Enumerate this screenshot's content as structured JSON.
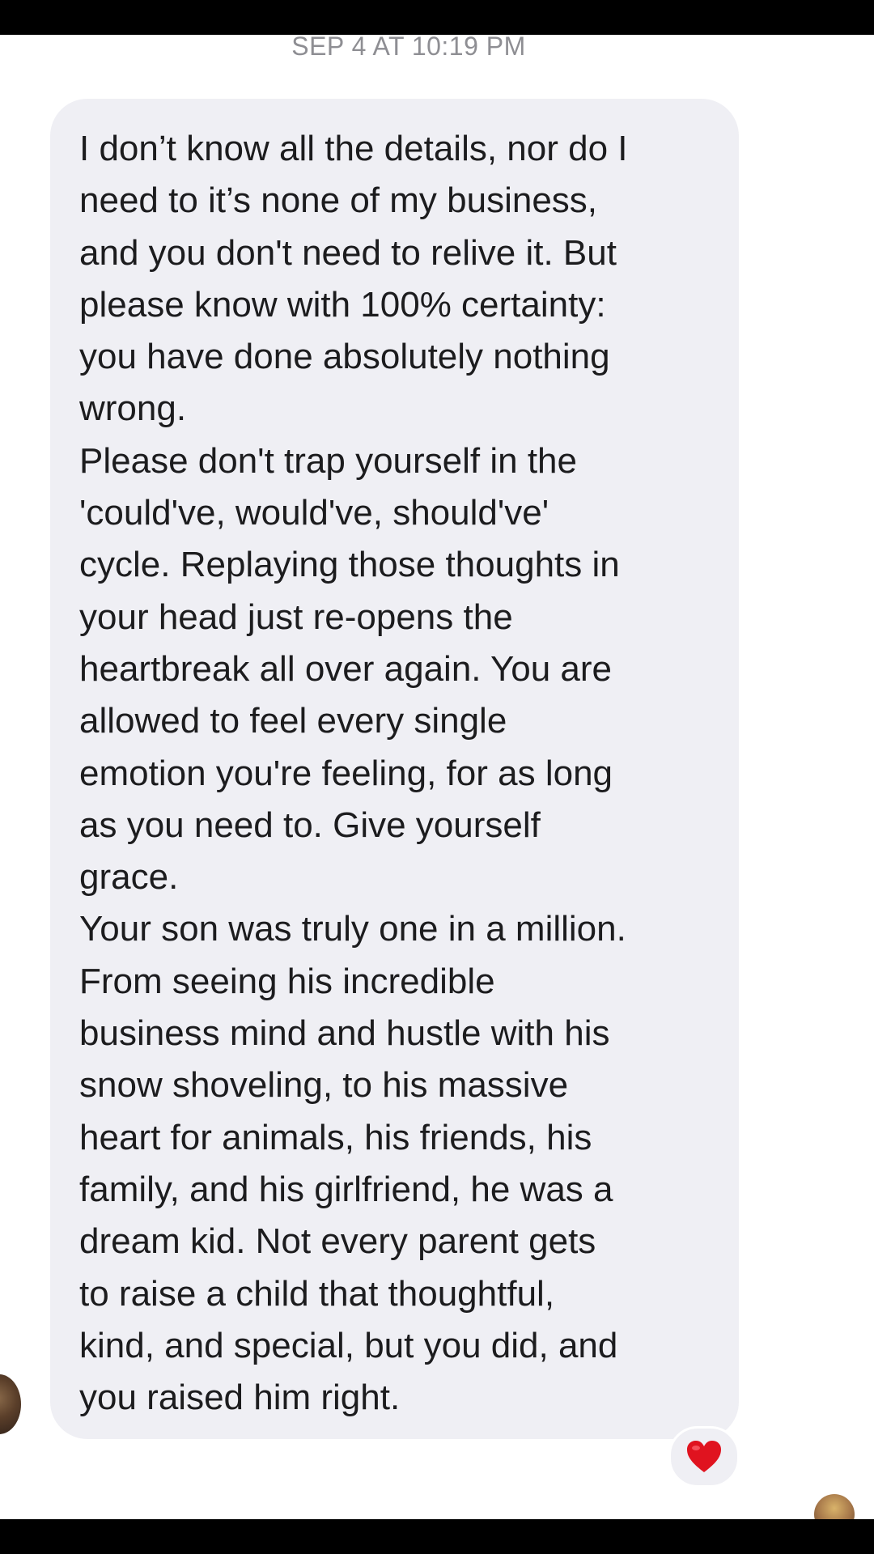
{
  "conversation": {
    "timestamp": "SEP 4 AT 10:19 PM",
    "message": {
      "lines": [
        "I don’t know all the details, nor do I",
        "need to it’s none of my business,",
        "and you don't need to relive it. But",
        "please know with 100% certainty:",
        "you have done absolutely nothing",
        "wrong.",
        "Please don't trap yourself in the",
        "'could've, would've, should've'",
        "cycle. Replaying those thoughts in",
        "your head just re-opens the",
        "heartbreak all over again. You are",
        "allowed to feel every single",
        "emotion you're feeling, for as long",
        "as you need to. Give yourself",
        "grace.",
        "Your son was truly one in a million.",
        "From seeing his incredible",
        "business mind and hustle with his",
        "snow shoveling, to his massive",
        "heart for animals, his friends, his",
        "family, and his girlfriend, he was a",
        "dream kid. Not every parent gets",
        "to raise a child that thoughtful,",
        "kind, and special, but you did, and",
        "you raised him right."
      ],
      "reaction": {
        "icon": "heart-icon",
        "color": "#e0131f"
      }
    }
  },
  "colors": {
    "bubble_background": "#efeff4",
    "message_text": "#1c1c1e",
    "timestamp_text": "#8e8e93"
  }
}
